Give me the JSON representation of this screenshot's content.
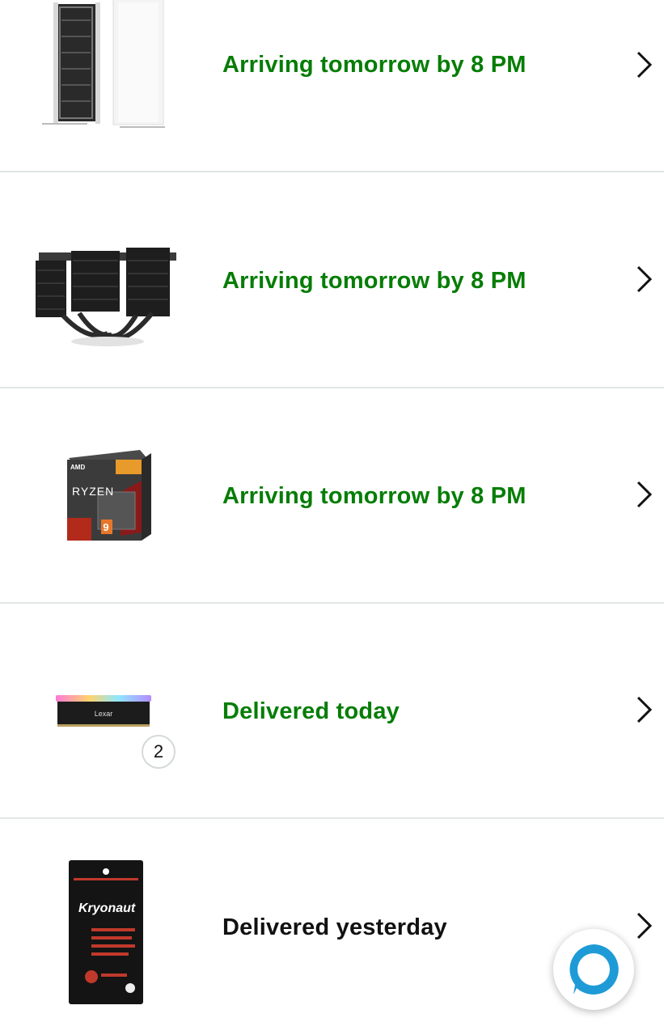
{
  "orders": [
    {
      "product": "Noctua NH-P1 passive CPU cooler (white fins, black heatpipes)",
      "icon": "cpu-cooler-white-image",
      "status": "Arriving tomorrow by 8 PM",
      "status_color": "#067d06"
    },
    {
      "product": "Noctua NH-D15 chromax.black dual tower CPU cooler",
      "icon": "cpu-cooler-black-image",
      "status": "Arriving tomorrow by 8 PM",
      "status_color": "#067d06"
    },
    {
      "product": "AMD Ryzen 9 processor box",
      "icon": "cpu-box-image",
      "status": "Arriving tomorrow by 8 PM",
      "status_color": "#067d06"
    },
    {
      "product": "Lexar RGB DDR memory module",
      "icon": "ram-module-image",
      "status": "Delivered today",
      "status_color": "#067d06",
      "quantity": "2"
    },
    {
      "product": "Thermal Grizzly Kryonaut thermal paste",
      "icon": "thermal-paste-image",
      "status": "Delivered yesterday",
      "status_color": "#111111"
    }
  ],
  "brand_text": {
    "ryzen": "RYZEN",
    "ryzen_tier": "9",
    "amd": "AMD",
    "lexar": "Lexar",
    "kryonaut": "Kryonaut"
  },
  "alexa_button": {
    "icon": "alexa-icon",
    "color": "#1e9bd7"
  }
}
